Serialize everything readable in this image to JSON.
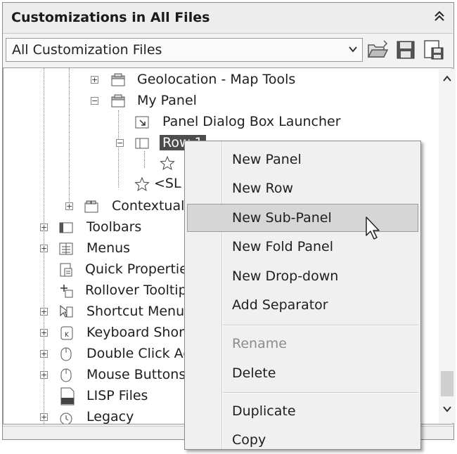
{
  "panel": {
    "title": "Customizations in All Files",
    "collapse_icon": "double-chevron-up"
  },
  "toolbar": {
    "dropdown_value": "All Customization Files"
  },
  "tree": {
    "items": [
      {
        "label": "Geolocation - Map Tools",
        "icon": "panel-icon",
        "expander": "+"
      },
      {
        "label": "My Panel",
        "icon": "panel-icon",
        "expander": "−"
      },
      {
        "label": "Panel Dialog Box Launcher",
        "icon": "dialog-launcher-icon"
      },
      {
        "label": "Row 1",
        "icon": "row-icon",
        "expander": "−",
        "selected": true
      },
      {
        "label": "",
        "icon": "star-icon"
      },
      {
        "label": "<SL",
        "icon": "star-icon"
      },
      {
        "label": "Contextual T",
        "icon": "contextual-tab-icon",
        "expander": "+"
      },
      {
        "label": "Toolbars",
        "icon": "toolbar-icon",
        "expander": "+"
      },
      {
        "label": "Menus",
        "icon": "menu-icon",
        "expander": "+"
      },
      {
        "label": "Quick Properties",
        "icon": "quick-properties-icon"
      },
      {
        "label": "Rollover Tooltip",
        "icon": "rollover-tooltip-icon"
      },
      {
        "label": "Shortcut Menus",
        "icon": "shortcut-menu-icon",
        "expander": "+"
      },
      {
        "label": "Keyboard Shortc",
        "icon": "keyboard-icon",
        "expander": "+"
      },
      {
        "label": "Double Click Ac",
        "icon": "mouse-icon",
        "expander": "+"
      },
      {
        "label": "Mouse Buttons",
        "icon": "mouse-icon",
        "expander": "+"
      },
      {
        "label": "LISP Files",
        "icon": "lisp-file-icon"
      },
      {
        "label": "Legacy",
        "icon": "legacy-icon",
        "expander": "+"
      }
    ]
  },
  "context_menu": {
    "items": [
      {
        "label": "New Panel"
      },
      {
        "label": "New Row"
      },
      {
        "label": "New Sub-Panel",
        "hover": true
      },
      {
        "label": "New Fold Panel"
      },
      {
        "label": "New Drop-down"
      },
      {
        "label": "Add Separator"
      },
      {
        "label": "Rename",
        "disabled": true
      },
      {
        "label": "Delete"
      },
      {
        "label": "Duplicate"
      },
      {
        "label": "Copy"
      }
    ]
  }
}
